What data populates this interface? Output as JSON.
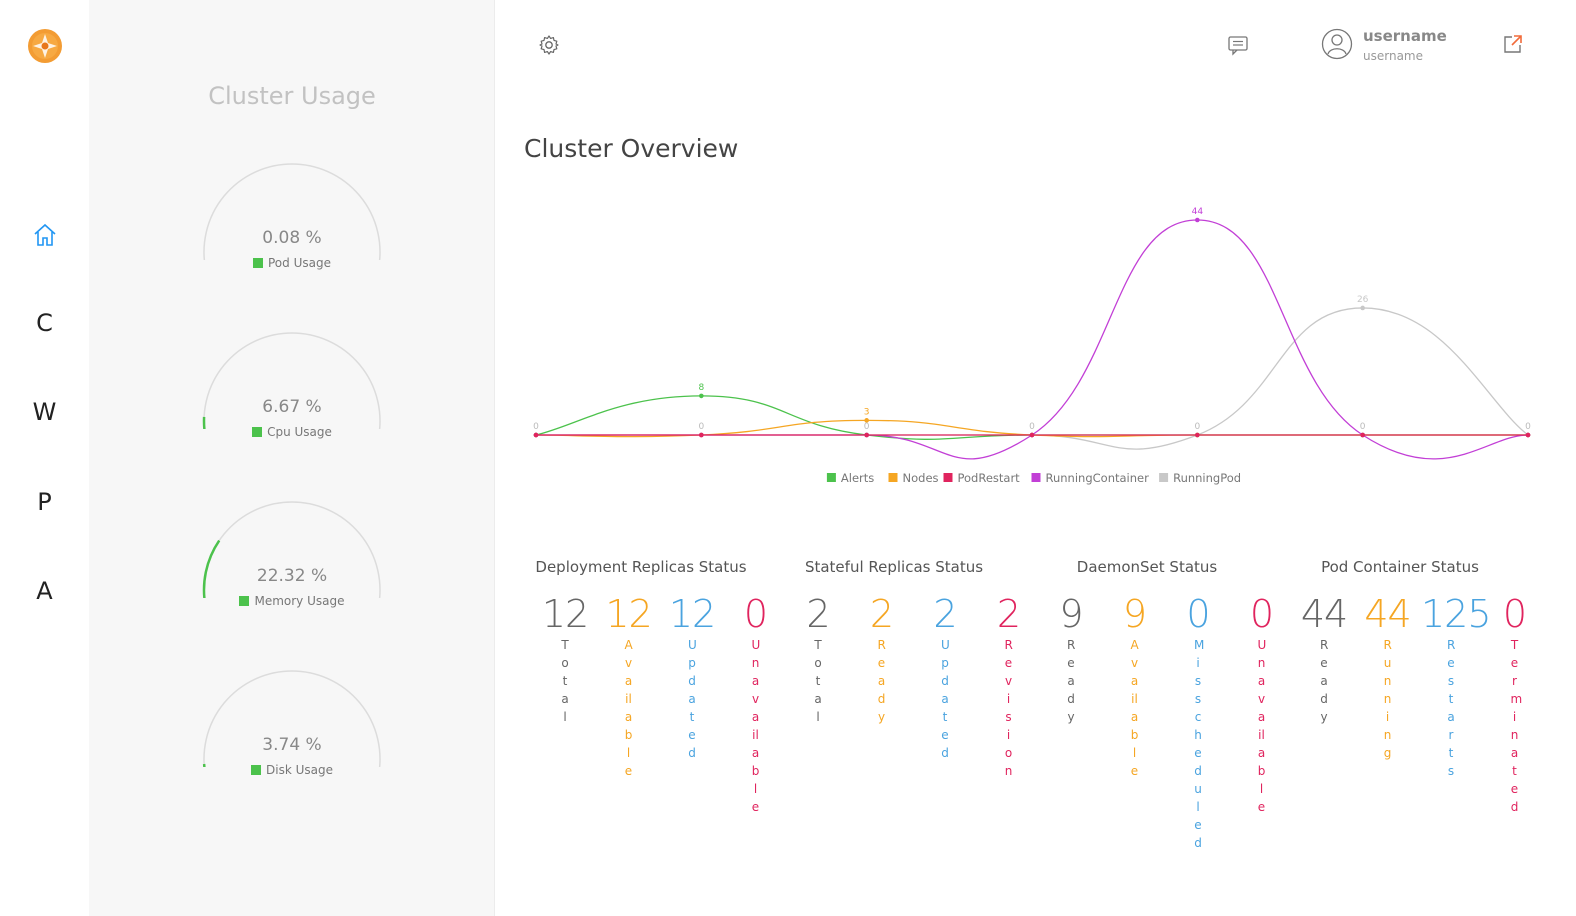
{
  "nav": {
    "items": [
      {
        "label": "",
        "icon": "home-icon"
      },
      {
        "label": "C"
      },
      {
        "label": "W"
      },
      {
        "label": "P"
      },
      {
        "label": "A"
      }
    ],
    "accent": "#2196f3"
  },
  "usage": {
    "title": "Cluster Usage",
    "gauges": [
      {
        "value_text": "0.08 %",
        "label": "Pod Usage",
        "percent": 0.08
      },
      {
        "value_text": "6.67 %",
        "label": "Cpu Usage",
        "percent": 6.67
      },
      {
        "value_text": "22.32 %",
        "label": "Memory Usage",
        "percent": 22.32
      },
      {
        "value_text": "3.74 %",
        "label": "Disk Usage",
        "percent": 3.74
      }
    ],
    "gauge_color": "#4cc24c"
  },
  "header": {
    "settings_icon": "gear-icon",
    "messages_icon": "chat-icon",
    "avatar_icon": "user-icon",
    "user_name": "username",
    "user_sub": "username",
    "logout_icon": "external-link-icon"
  },
  "main": {
    "title": "Cluster Overview"
  },
  "chart_data": {
    "type": "line",
    "x": [
      0,
      1,
      2,
      3,
      4,
      5,
      6
    ],
    "series": [
      {
        "name": "Alerts",
        "color": "#4cc24c",
        "values": [
          0,
          8,
          0,
          0,
          0,
          0,
          0
        ]
      },
      {
        "name": "Nodes",
        "color": "#f5a623",
        "values": [
          0,
          0,
          3,
          0,
          0,
          0,
          0
        ]
      },
      {
        "name": "PodRestart",
        "color": "#e0245e",
        "values": [
          0,
          0,
          0,
          0,
          0,
          0,
          0
        ]
      },
      {
        "name": "RunningContainer",
        "color": "#c23fd6",
        "values": [
          0,
          0,
          0,
          0,
          44,
          0,
          0
        ]
      },
      {
        "name": "RunningPod",
        "color": "#c8c8c8",
        "values": [
          0,
          0,
          0,
          0,
          0,
          26,
          0
        ]
      }
    ],
    "ylim": [
      0,
      44
    ],
    "legend": "bottom",
    "grid": false,
    "point_labels": [
      {
        "x": 0,
        "text": "0"
      },
      {
        "x": 1,
        "text": "8"
      },
      {
        "x": 1,
        "text": "0"
      },
      {
        "x": 2,
        "text": "3"
      },
      {
        "x": 2,
        "text": "0"
      },
      {
        "x": 3,
        "text": "0"
      },
      {
        "x": 4,
        "text": "44"
      },
      {
        "x": 4,
        "text": "0"
      },
      {
        "x": 5,
        "text": "26"
      },
      {
        "x": 5,
        "text": "0"
      },
      {
        "x": 6,
        "text": "0"
      }
    ]
  },
  "status": {
    "groups": [
      {
        "title": "Deployment Replicas Status",
        "items": [
          {
            "value": "12",
            "label": "Total",
            "color": "gray"
          },
          {
            "value": "12",
            "label": "Available",
            "color": "orange"
          },
          {
            "value": "12",
            "label": "Updated",
            "color": "blue"
          },
          {
            "value": "0",
            "label": "Unavailable",
            "color": "red"
          }
        ]
      },
      {
        "title": "Stateful Replicas Status",
        "items": [
          {
            "value": "2",
            "label": "Total",
            "color": "gray"
          },
          {
            "value": "2",
            "label": "Ready",
            "color": "orange"
          },
          {
            "value": "2",
            "label": "Updated",
            "color": "blue"
          },
          {
            "value": "2",
            "label": "Revision",
            "color": "red"
          }
        ]
      },
      {
        "title": "DaemonSet Status",
        "items": [
          {
            "value": "9",
            "label": "Ready",
            "color": "gray"
          },
          {
            "value": "9",
            "label": "Available",
            "color": "orange"
          },
          {
            "value": "0",
            "label": "Misscheduled",
            "color": "blue"
          },
          {
            "value": "0",
            "label": "Unavailable",
            "color": "red"
          }
        ]
      },
      {
        "title": "Pod Container Status",
        "items": [
          {
            "value": "44",
            "label": "Ready",
            "color": "gray"
          },
          {
            "value": "44",
            "label": "Running",
            "color": "orange"
          },
          {
            "value": "125",
            "label": "Restarts",
            "color": "blue"
          },
          {
            "value": "0",
            "label": "Terminated",
            "color": "red"
          }
        ]
      }
    ]
  }
}
